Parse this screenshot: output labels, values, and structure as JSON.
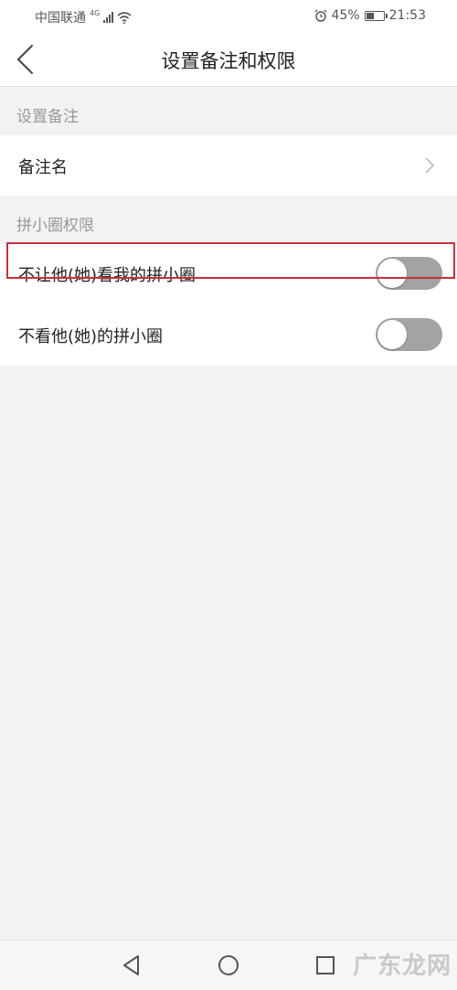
{
  "status_bar": {
    "carrier": "中国联通",
    "network_type": "4G",
    "battery_percent": "45%",
    "battery_level": 0.45,
    "time": "21:53"
  },
  "header": {
    "title": "设置备注和权限"
  },
  "remark_section": {
    "header": "设置备注",
    "remark_label": "备注名"
  },
  "permission_section": {
    "header": "拼小圈权限",
    "items": [
      {
        "label": "不让他(她)看我的拼小圈",
        "enabled": false
      },
      {
        "label": "不看他(她)的拼小圈",
        "enabled": false
      }
    ]
  },
  "watermark": "广东龙网",
  "colors": {
    "accent_highlight": "#c9303a",
    "switch_off": "#a3a3a3",
    "page_background": "#f2f2f2"
  }
}
